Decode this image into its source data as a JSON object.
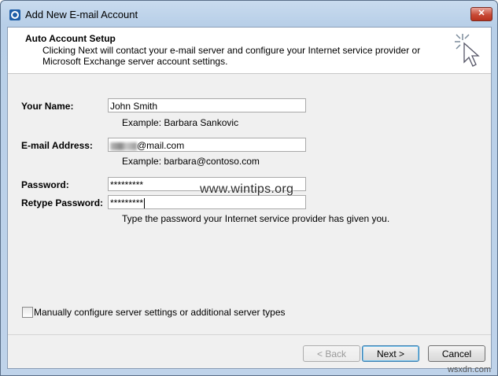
{
  "window": {
    "title": "Add New E-mail Account",
    "close_glyph": "✕"
  },
  "header": {
    "title": "Auto Account Setup",
    "description": "Clicking Next will contact your e-mail server and configure your Internet service provider or Microsoft Exchange server account settings.",
    "icon": "cursor-click-icon"
  },
  "form": {
    "name_label": "Your Name:",
    "name_value": "John Smith",
    "name_example": "Example: Barbara Sankovic",
    "email_label": "E-mail Address:",
    "email_value_suffix": "@mail.com",
    "email_example": "Example: barbara@contoso.com",
    "password_label": "Password:",
    "password_value": "*********",
    "retype_label": "Retype Password:",
    "retype_value": "*********",
    "password_hint": "Type the password your Internet service provider has given you."
  },
  "watermark": "www.wintips.org",
  "manual_config": {
    "label": "Manually configure server settings or additional server types",
    "checked": false
  },
  "buttons": {
    "back": "< Back",
    "next": "Next >",
    "cancel": "Cancel"
  },
  "credit": "wsxdn.com"
}
